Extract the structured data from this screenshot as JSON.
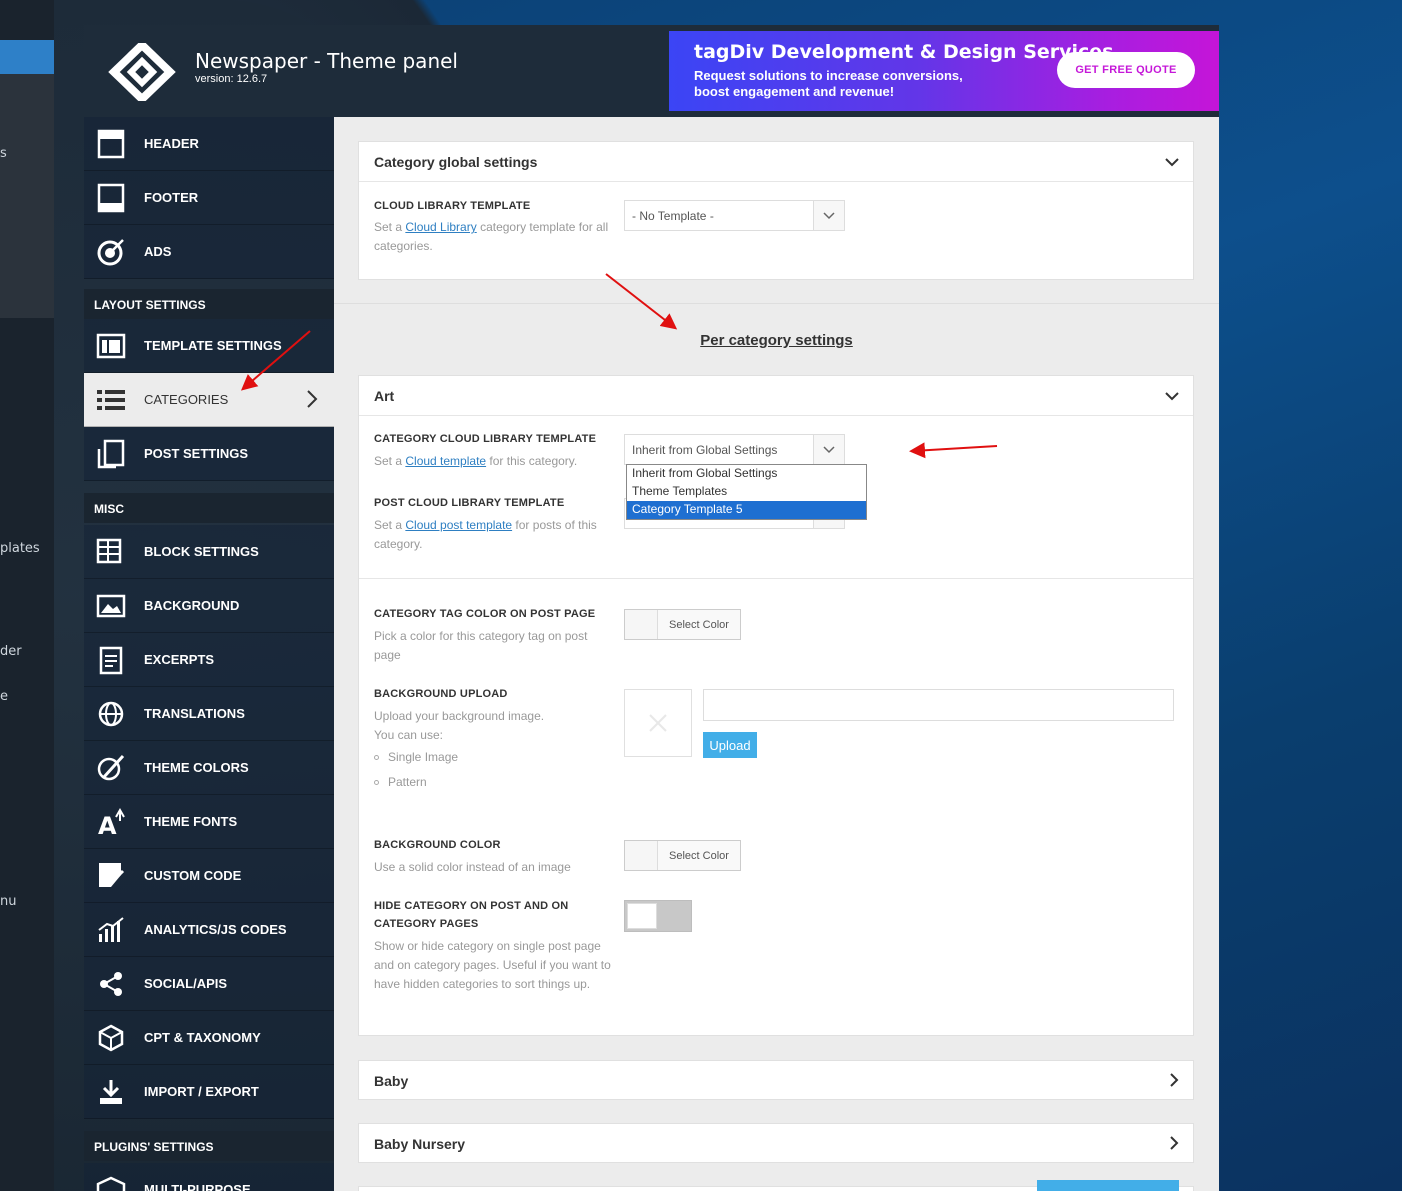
{
  "app": {
    "title": "Newspaper - Theme panel",
    "version": "version: 12.6.7"
  },
  "banner": {
    "title": "tagDiv Development & Design Services",
    "line1": "Request solutions to increase conversions,",
    "line2": "boost engagement and revenue!",
    "button": "GET FREE QUOTE"
  },
  "background_text": {
    "fragment1": "s",
    "fragment2": "plates",
    "fragment3": "der",
    "fragment4": "e",
    "fragment5": "nu"
  },
  "sidebar": {
    "items": [
      {
        "label": "HEADER",
        "icon": "header-icon"
      },
      {
        "label": "FOOTER",
        "icon": "footer-icon"
      },
      {
        "label": "ADS",
        "icon": "target-icon"
      }
    ],
    "section_layout": "LAYOUT SETTINGS",
    "layout_items": [
      {
        "label": "TEMPLATE SETTINGS",
        "icon": "template-icon"
      },
      {
        "label": "CATEGORIES",
        "icon": "list-icon",
        "active": true
      },
      {
        "label": "POST SETTINGS",
        "icon": "post-icon"
      }
    ],
    "section_misc": "MISC",
    "misc_items": [
      {
        "label": "BLOCK SETTINGS",
        "icon": "block-icon"
      },
      {
        "label": "BACKGROUND",
        "icon": "image-icon"
      },
      {
        "label": "EXCERPTS",
        "icon": "excerpt-icon"
      },
      {
        "label": "TRANSLATIONS",
        "icon": "globe-icon"
      },
      {
        "label": "THEME COLORS",
        "icon": "brush-icon"
      },
      {
        "label": "THEME FONTS",
        "icon": "font-icon"
      },
      {
        "label": "CUSTOM CODE",
        "icon": "code-icon"
      },
      {
        "label": "ANALYTICS/JS CODES",
        "icon": "analytics-icon"
      },
      {
        "label": "SOCIAL/APIS",
        "icon": "share-icon"
      },
      {
        "label": "CPT & TAXONOMY",
        "icon": "cube-icon"
      },
      {
        "label": "IMPORT / EXPORT",
        "icon": "download-icon"
      }
    ],
    "section_plugins": "PLUGINS' SETTINGS",
    "plugin_items": [
      {
        "label": "MULTI-PURPOSE",
        "icon": "box-icon"
      }
    ]
  },
  "global_card": {
    "title": "Category global settings",
    "option_title": "CLOUD LIBRARY TEMPLATE",
    "desc_prefix": "Set a ",
    "desc_link": "Cloud Library",
    "desc_suffix": " category template for all categories.",
    "select_value": "- No Template -"
  },
  "per_category_heading": "Per category settings",
  "art_card": {
    "title": "Art",
    "cat_template_title": "CATEGORY CLOUD LIBRARY TEMPLATE",
    "cat_template_desc_prefix": "Set a ",
    "cat_template_desc_link": "Cloud template",
    "cat_template_desc_suffix": " for this category.",
    "cat_template_value": "Inherit from Global Settings",
    "dropdown_options": [
      "Inherit from Global Settings",
      "Theme Templates",
      "Category Template 5"
    ],
    "post_template_title": "POST CLOUD LIBRARY TEMPLATE",
    "post_template_desc_prefix": "Set a ",
    "post_template_desc_link": "Cloud post template",
    "post_template_desc_suffix": " for posts of this category.",
    "tag_color_title": "CATEGORY TAG COLOR ON POST PAGE",
    "tag_color_desc": "Pick a color for this category tag on post page",
    "select_color": "Select Color",
    "bg_upload_title": "BACKGROUND UPLOAD",
    "bg_upload_desc1": "Upload your background image.",
    "bg_upload_desc2": "You can use:",
    "bg_upload_opt1": "Single Image",
    "bg_upload_opt2": "Pattern",
    "upload_button": "Upload",
    "bg_color_title": "BACKGROUND COLOR",
    "bg_color_desc": "Use a solid color instead of an image",
    "hide_title_line1": "HIDE CATEGORY ON POST AND ON",
    "hide_title_line2": "CATEGORY PAGES",
    "hide_desc": "Show or hide category on single post page and on category pages. Useful if you want to have hidden categories to sort things up."
  },
  "collapsed_cards": [
    "Baby",
    "Baby Nursery"
  ]
}
